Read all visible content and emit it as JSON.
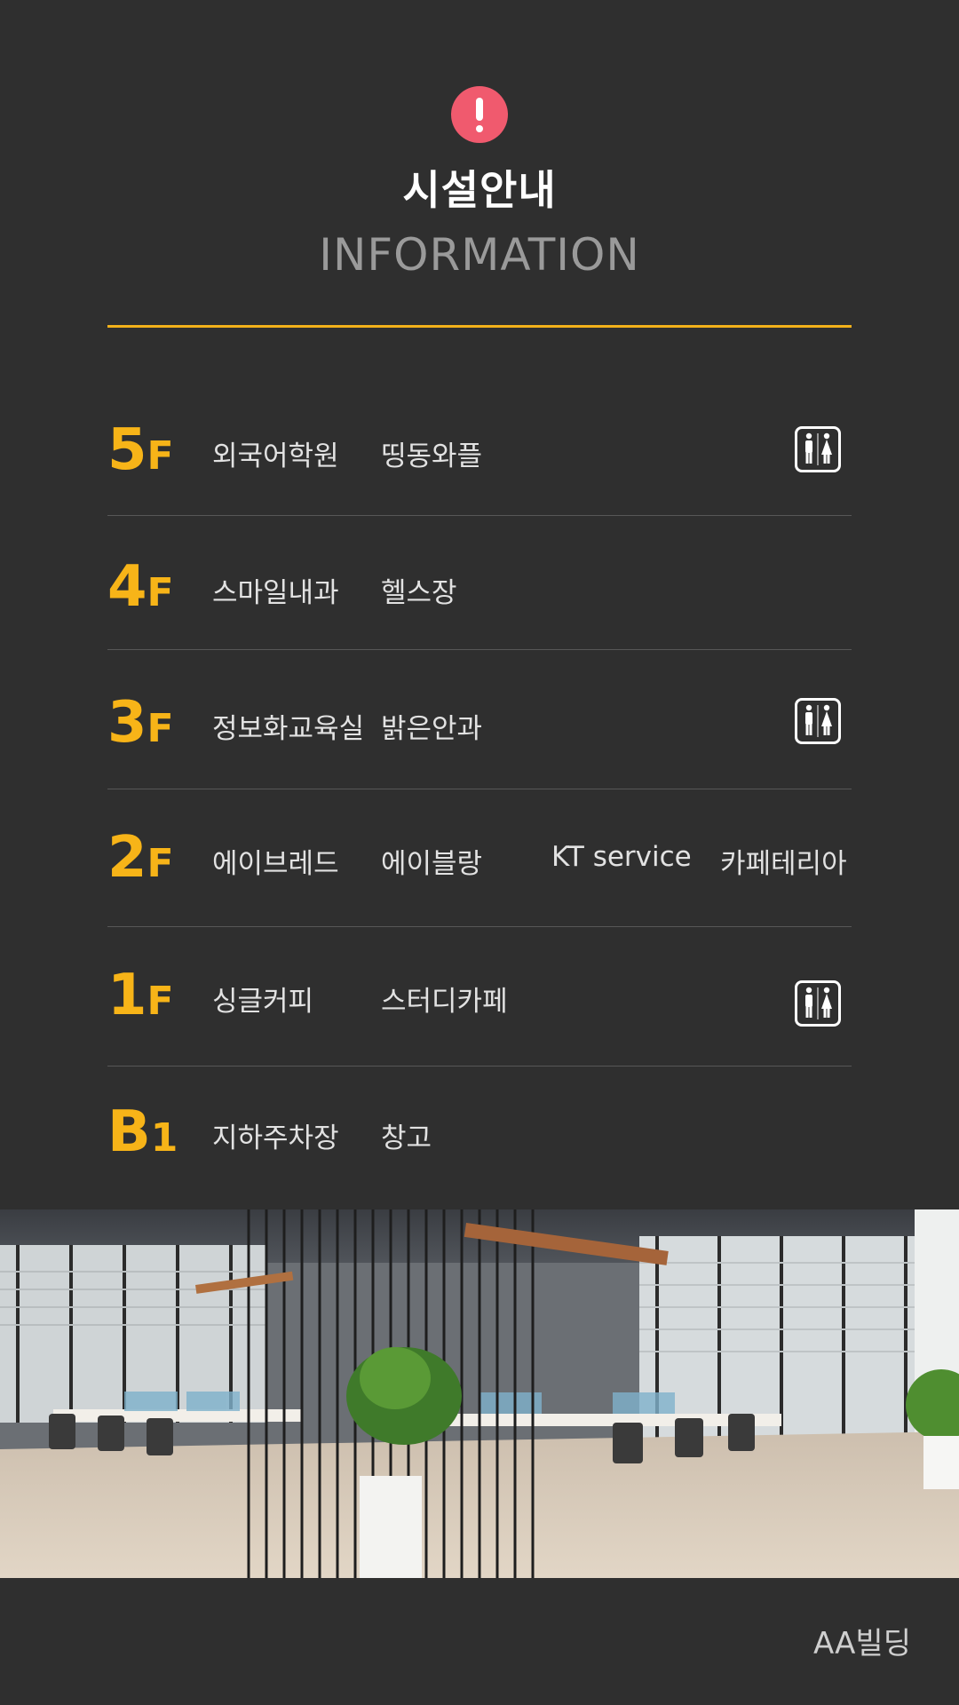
{
  "header": {
    "icon": "exclamation-circle-icon",
    "title": "시설안내",
    "subtitle": "INFORMATION"
  },
  "colors": {
    "background": "#2f2f2f",
    "accent_gold": "#f7b418",
    "alert_pink": "#f05a6e"
  },
  "floors": [
    {
      "num": "5",
      "unit": "F",
      "tenants": [
        "외국어학원",
        "띵동와플",
        "",
        ""
      ],
      "restroom": true
    },
    {
      "num": "4",
      "unit": "F",
      "tenants": [
        "스마일내과",
        "헬스장",
        "",
        ""
      ],
      "restroom": false
    },
    {
      "num": "3",
      "unit": "F",
      "tenants": [
        "정보화교육실",
        "밝은안과",
        "",
        ""
      ],
      "restroom": true
    },
    {
      "num": "2",
      "unit": "F",
      "tenants": [
        "에이브레드",
        "에이블랑",
        "KT service",
        "카페테리아"
      ],
      "restroom": false
    },
    {
      "num": "1",
      "unit": "F",
      "tenants": [
        "싱글커피",
        "스터디카페",
        "",
        ""
      ],
      "restroom": true
    },
    {
      "num": "B",
      "unit": "1",
      "tenants": [
        "지하주차장",
        "창고",
        "",
        ""
      ],
      "restroom": false
    }
  ],
  "restroom_icon": "restroom-icon",
  "photo": {
    "subject": "office-interior-photo"
  },
  "footer": {
    "building_name": "AA빌딩"
  }
}
